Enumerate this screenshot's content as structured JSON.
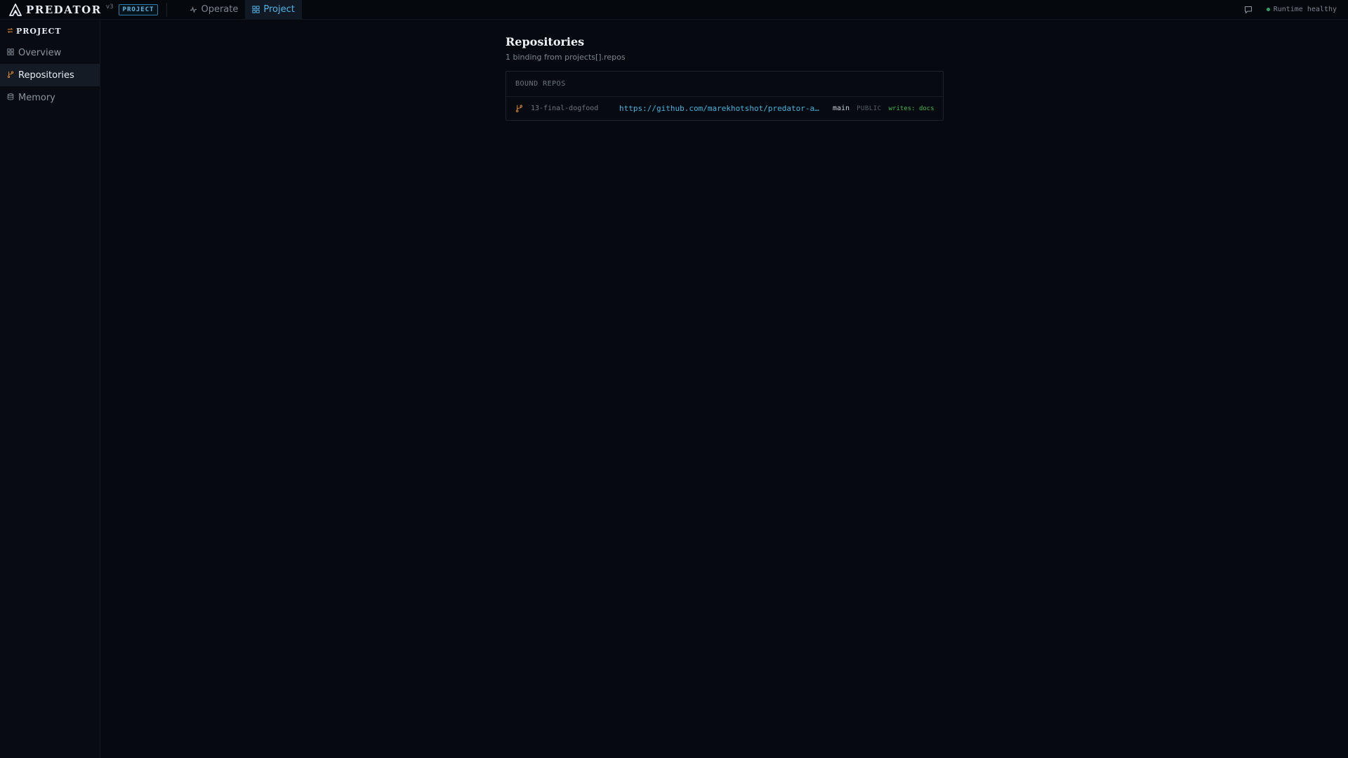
{
  "app": {
    "name": "PREDATOR",
    "version": "v3",
    "context_badge": "PROJECT"
  },
  "nav": {
    "tabs": [
      {
        "label": "Operate",
        "icon": "activity-icon",
        "active": false
      },
      {
        "label": "Project",
        "icon": "grid-icon",
        "active": true
      }
    ]
  },
  "status": {
    "runtime": "Runtime healthy",
    "color": "#2ea36a"
  },
  "sidebar": {
    "header": "PROJECT",
    "items": [
      {
        "label": "Overview",
        "icon": "grid-icon",
        "active": false
      },
      {
        "label": "Repositories",
        "icon": "git-branch-icon",
        "active": true
      },
      {
        "label": "Memory",
        "icon": "database-icon",
        "active": false
      }
    ]
  },
  "main": {
    "title": "Repositories",
    "subtitle": "1 binding from projects[].repos",
    "card": {
      "header": "BOUND REPOS",
      "repos": [
        {
          "name": "13-final-dogfood",
          "url": "https://github.com/marekhotshot/predator-alpha",
          "branch": "main",
          "visibility": "PUBLIC",
          "writes": "writes: docs"
        }
      ]
    }
  },
  "colors": {
    "accent": "#4fb3e8",
    "brand_orange": "#e08a2c",
    "link": "#3fb5e0",
    "success": "#3fb950",
    "background": "#060a10"
  }
}
